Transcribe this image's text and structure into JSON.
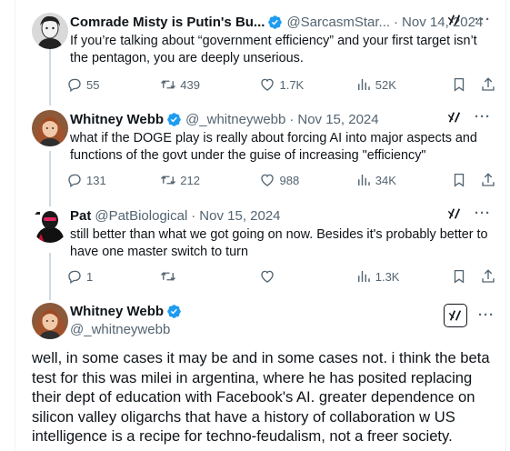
{
  "tweets": [
    {
      "name": "Comrade Misty is Putin's Bu...",
      "handle": "@SarcasmStar...",
      "date": "Nov 14, 2024",
      "text": "If you’re talking about “government efficiency” and your first target isn’t the pentagon, you are deeply unserious.",
      "replies": "55",
      "reposts": "439",
      "likes": "1.7K",
      "views": "52K"
    },
    {
      "name": "Whitney Webb",
      "handle": "@_whitneywebb",
      "date": "Nov 15, 2024",
      "text": "what if the DOGE play is really about forcing AI into major aspects and functions of the govt under the guise of increasing \"efficiency\"",
      "replies": "131",
      "reposts": "212",
      "likes": "988",
      "views": "34K"
    },
    {
      "name": "Pat",
      "handle": "@PatBiological",
      "date": "Nov 15, 2024",
      "text": "still better than what we got going on now. Besides it's probably better to have one master switch to turn",
      "replies": "1",
      "reposts": "",
      "likes": "",
      "views": "1.3K"
    }
  ],
  "main": {
    "name": "Whitney Webb",
    "handle": "@_whitneywebb",
    "text": "well, in some cases it may be and in some cases not. i think the beta test for this was milei in argentina, where he has posited replacing their dept of education with Facebook's AI. greater dependence on silicon valley oligarchs that have a history of collaboration w US intelligence is a recipe for techno-feudalism, not a freer society."
  },
  "separator": "·",
  "more_label": "···",
  "icons": {
    "verified": "verified-badge-icon",
    "grok": "grok-icon",
    "reply": "reply-icon",
    "repost": "repost-icon",
    "like": "heart-icon",
    "views": "views-icon",
    "bookmark": "bookmark-icon",
    "share": "share-icon"
  },
  "colors": {
    "verified": "#1d9bf0",
    "secondary_text": "#536471",
    "primary_text": "#0f1419",
    "thread_line": "#cfd9de"
  }
}
